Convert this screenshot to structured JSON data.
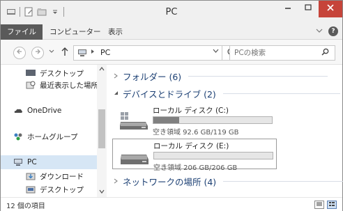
{
  "window": {
    "title": "PC"
  },
  "ribbon": {
    "file_tab": "ファイル",
    "computer_tab": "コンピューター",
    "view_tab": "表示",
    "help_label": "?"
  },
  "nav": {
    "breadcrumb": "PC",
    "search_placeholder": "PCの検索"
  },
  "sidebar": {
    "items": [
      {
        "label": "デスクトップ",
        "icon": "desktop-icon"
      },
      {
        "label": "最近表示した場所",
        "icon": "recent-places-icon"
      },
      {
        "label": "OneDrive",
        "icon": "onedrive-icon"
      },
      {
        "label": "ホームグループ",
        "icon": "homegroup-icon"
      },
      {
        "label": "PC",
        "icon": "pc-icon",
        "selected": true
      },
      {
        "label": "ダウンロード",
        "icon": "downloads-icon"
      },
      {
        "label": "デスクトップ",
        "icon": "desktop-folder-icon"
      }
    ]
  },
  "content": {
    "groups": {
      "folders": "フォルダー (6)",
      "devices": "デバイスとドライブ (2)",
      "network": "ネットワークの場所 (4)"
    },
    "drives": [
      {
        "name": "ローカル ディスク (C:)",
        "free_text": "空き領域 92.6 GB/119 GB",
        "used_fraction": 0.22,
        "selected": false
      },
      {
        "name": "ローカル ディスク (E:)",
        "free_text": "空き領域 206 GB/206 GB",
        "used_fraction": 0.0,
        "selected": true
      }
    ]
  },
  "status": {
    "item_count": "12 個の項目"
  },
  "colors": {
    "close_button": "#c6443a",
    "file_tab": "#5a5a5a",
    "group_heading": "#1b3f73",
    "drive_fill": "#808080",
    "selection": "#d6e6f5"
  }
}
